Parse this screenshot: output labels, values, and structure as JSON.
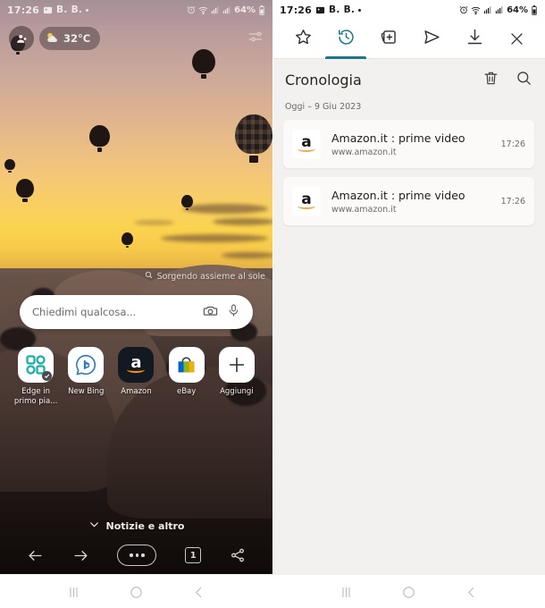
{
  "left": {
    "statusbar": {
      "time": "17:26",
      "app_label": "B. B.",
      "battery": "64%",
      "icons": [
        "image-icon",
        "dot-icon",
        "alarm-icon",
        "wifi-icon",
        "signal-icon",
        "signal2-icon",
        "battery-icon"
      ]
    },
    "avatar": "person-avatar",
    "weather": {
      "temperature": "32°C",
      "icon": "sun-cloud-icon"
    },
    "settings_icon": "sliders-icon",
    "background_caption": "Sorgendo assieme al sole",
    "search": {
      "placeholder": "Chiedimi qualcosa...",
      "camera_icon": "camera-icon",
      "mic_icon": "microphone-icon"
    },
    "tiles": [
      {
        "label": "Edge in primo pia...",
        "icon": "edge-collections-icon"
      },
      {
        "label": "New Bing",
        "icon": "bing-chat-icon"
      },
      {
        "label": "Amazon",
        "icon": "amazon-icon"
      },
      {
        "label": "eBay",
        "icon": "ebay-icon"
      },
      {
        "label": "Aggiungi",
        "icon": "plus-icon"
      }
    ],
    "news_label": "Notizie e altro",
    "news_chevron": "chevron-down-icon",
    "toolbar": {
      "back": "back-arrow-icon",
      "forward": "forward-arrow-icon",
      "menu": "more-options-icon",
      "tab_count": "1",
      "share": "share-icon"
    }
  },
  "right": {
    "statusbar": {
      "time": "17:26",
      "app_label": "B. B.",
      "battery": "64%"
    },
    "hub_tabs": [
      {
        "name": "favorites",
        "icon": "star-icon",
        "active": false
      },
      {
        "name": "history",
        "icon": "history-clock-icon",
        "active": true
      },
      {
        "name": "collections",
        "icon": "collections-add-icon",
        "active": false
      },
      {
        "name": "shared",
        "icon": "send-icon",
        "active": false
      },
      {
        "name": "downloads",
        "icon": "download-icon",
        "active": false
      }
    ],
    "close_icon": "close-icon",
    "title": "Cronologia",
    "header_actions": [
      {
        "name": "delete",
        "icon": "trash-icon"
      },
      {
        "name": "search",
        "icon": "search-icon"
      }
    ],
    "date_group": "Oggi – 9 Giu 2023",
    "items": [
      {
        "title": "Amazon.it : prime video",
        "url": "www.amazon.it",
        "time": "17:26",
        "favicon": "amazon-favicon"
      },
      {
        "title": "Amazon.it : prime video",
        "url": "www.amazon.it",
        "time": "17:26",
        "favicon": "amazon-favicon"
      }
    ],
    "accent_color": "#177a8a"
  },
  "navbar": {
    "recents": "recents-icon",
    "home": "home-icon",
    "back": "back-icon"
  }
}
